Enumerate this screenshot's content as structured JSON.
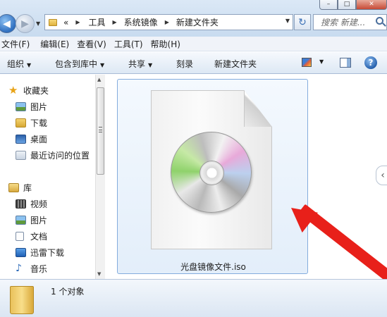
{
  "window": {
    "controls": [
      "–",
      "□",
      "✕"
    ]
  },
  "address": {
    "overflow": "«",
    "crumbs": [
      "工具",
      "系统镜像",
      "新建文件夹"
    ],
    "search_placeholder": "搜索 新建..."
  },
  "menu": [
    "文件(F)",
    "编辑(E)",
    "查看(V)",
    "工具(T)",
    "帮助(H)"
  ],
  "toolbar": {
    "organize": "组织",
    "include_library": "包含到库中",
    "share": "共享",
    "burn": "刻录",
    "new_folder": "新建文件夹"
  },
  "nav": {
    "favorites_title": "收藏夹",
    "favorites": [
      "图片",
      "下载",
      "桌面",
      "最近访问的位置"
    ],
    "libraries_title": "库",
    "libraries": [
      "视频",
      "图片",
      "文档",
      "迅雷下载",
      "音乐"
    ]
  },
  "content": {
    "file_name": "光盘镜像文件.iso"
  },
  "details": {
    "count": "1 个对象"
  },
  "colors": {
    "annotation_arrow": "#e8201a",
    "selection_border": "#84acdd",
    "help_blue": "#1f5aa8"
  },
  "icons": {
    "back": "back-arrow-icon",
    "forward": "forward-arrow-icon",
    "refresh": "refresh-icon",
    "search": "search-icon",
    "help": "help-icon",
    "file": "disc-image-icon"
  }
}
